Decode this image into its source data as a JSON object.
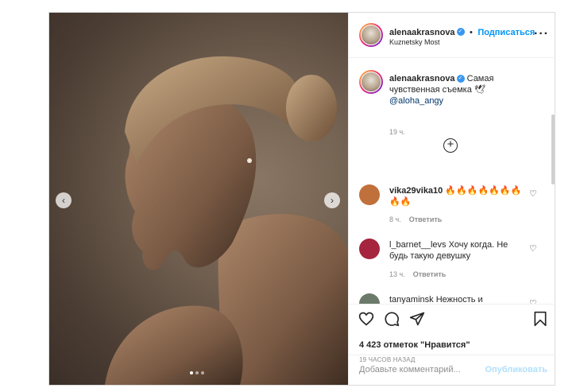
{
  "post": {
    "header": {
      "username": "alenaakrasnova",
      "follow_label": "Подписаться",
      "separator": "•",
      "location": "Kuznetsky Most",
      "more_label": "···"
    },
    "caption": {
      "username": "alenaakrasnova",
      "text": "Самая чувственная съемка 🕊",
      "mention": "@aloha_angy",
      "time": "19 ч."
    },
    "load_more_icon": "plus-circle-icon",
    "comments": [
      {
        "username": "vika29vika10",
        "text": "🔥🔥🔥🔥🔥🔥🔥🔥🔥",
        "time": "8 ч.",
        "reply_label": "Ответить",
        "avatar_color": "#c0703a"
      },
      {
        "username": "l_barnet__levs",
        "text": "Хочу когда. Не будь такую девушку",
        "time": "13 ч.",
        "reply_label": "Ответить",
        "avatar_color": "#a5243e"
      },
      {
        "username": "tanyaminsk",
        "text": "Нежность и",
        "time": "",
        "reply_label": "",
        "avatar_color": "#6b7a6a"
      }
    ],
    "likes_text": "4 423 отметок \"Нравится\"",
    "posted_time": "19 ЧАСОВ НАЗАД",
    "comment_placeholder": "Добавьте комментарий...",
    "publish_label": "Опубликовать",
    "carousel": {
      "prev_icon": "chevron-left-icon",
      "next_icon": "chevron-right-icon",
      "slide_count": 3,
      "active_index": 1
    }
  }
}
